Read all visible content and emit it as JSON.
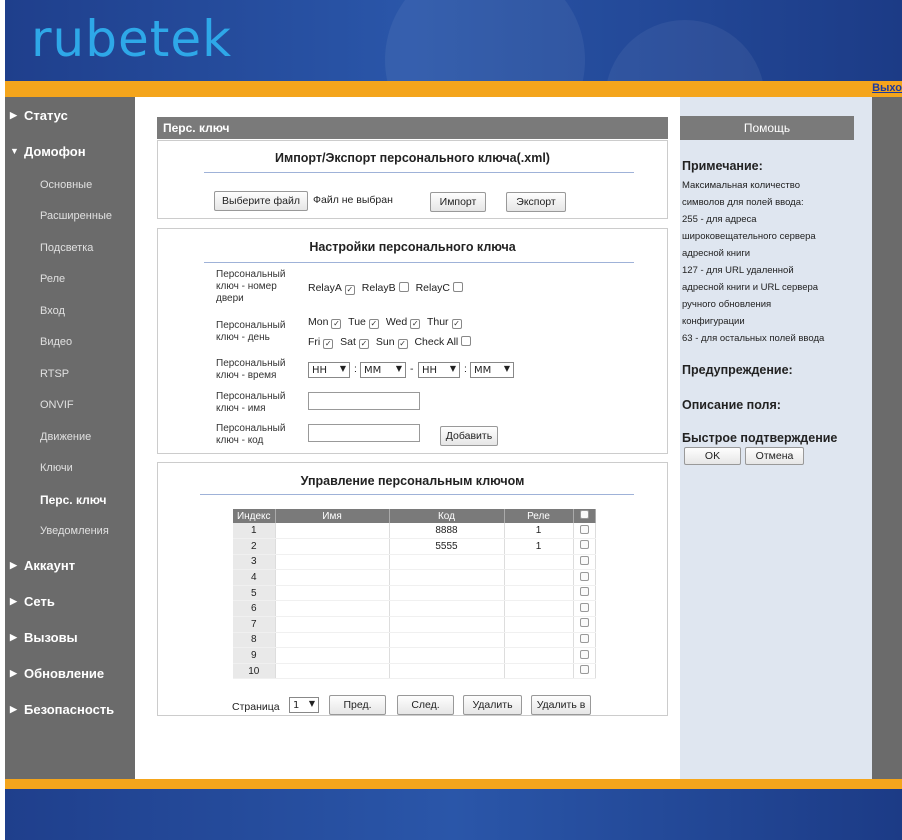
{
  "header": {
    "logo": "rubetek",
    "logout": "Выхо"
  },
  "sidebar": [
    {
      "label": "Статус",
      "type": "top",
      "expanded": false
    },
    {
      "label": "Домофон",
      "type": "top",
      "expanded": true
    },
    {
      "label": "Основные",
      "type": "sub"
    },
    {
      "label": "Расширенные",
      "type": "sub"
    },
    {
      "label": "Подсветка",
      "type": "sub"
    },
    {
      "label": "Реле",
      "type": "sub"
    },
    {
      "label": "Вход",
      "type": "sub"
    },
    {
      "label": "Видео",
      "type": "sub"
    },
    {
      "label": "RTSP",
      "type": "sub"
    },
    {
      "label": "ONVIF",
      "type": "sub"
    },
    {
      "label": "Движение",
      "type": "sub"
    },
    {
      "label": "Ключи",
      "type": "sub"
    },
    {
      "label": "Перс. ключ",
      "type": "sub",
      "active": true
    },
    {
      "label": "Уведомления",
      "type": "sub"
    },
    {
      "label": "Аккаунт",
      "type": "top",
      "expanded": false
    },
    {
      "label": "Сеть",
      "type": "top",
      "expanded": false
    },
    {
      "label": "Вызовы",
      "type": "top",
      "expanded": false
    },
    {
      "label": "Обновление",
      "type": "top",
      "expanded": false
    },
    {
      "label": "Безопасность",
      "type": "top",
      "expanded": false
    }
  ],
  "page_title": "Перс. ключ",
  "import_export": {
    "title": "Импорт/Экспорт персонального ключа(.xml)",
    "choose_file": "Выберите файл",
    "no_file": "Файл не выбран",
    "import": "Импорт",
    "export": "Экспорт"
  },
  "settings": {
    "title": "Настройки персонального ключа",
    "door_label": "Персональный ключ - номер двери",
    "relays": [
      {
        "label": "RelayA",
        "checked": true
      },
      {
        "label": "RelayB",
        "checked": false
      },
      {
        "label": "RelayC",
        "checked": false
      }
    ],
    "day_label": "Персональный ключ - день",
    "days_row1": [
      {
        "label": "Mon",
        "checked": true
      },
      {
        "label": "Tue",
        "checked": true
      },
      {
        "label": "Wed",
        "checked": true
      },
      {
        "label": "Thur",
        "checked": true
      }
    ],
    "days_row2": [
      {
        "label": "Fri",
        "checked": true
      },
      {
        "label": "Sat",
        "checked": true
      },
      {
        "label": "Sun",
        "checked": true
      },
      {
        "label": "Check All",
        "checked": false
      }
    ],
    "time_label": "Персональный ключ - время",
    "time_start_hh": "HH",
    "time_start_mm": "MM",
    "time_end_hh": "HH",
    "time_end_mm": "MM",
    "colon": ":",
    "dash": "-",
    "name_label": "Персональный ключ - имя",
    "code_label": "Персональный ключ - код",
    "add": "Добавить"
  },
  "management": {
    "title": "Управление персональным ключом",
    "columns": [
      "Индекс",
      "Имя",
      "Код",
      "Реле"
    ],
    "rows": [
      {
        "index": "1",
        "name": "",
        "code": "8888",
        "relay": "1"
      },
      {
        "index": "2",
        "name": "",
        "code": "5555",
        "relay": "1"
      },
      {
        "index": "3",
        "name": "",
        "code": "",
        "relay": ""
      },
      {
        "index": "4",
        "name": "",
        "code": "",
        "relay": ""
      },
      {
        "index": "5",
        "name": "",
        "code": "",
        "relay": ""
      },
      {
        "index": "6",
        "name": "",
        "code": "",
        "relay": ""
      },
      {
        "index": "7",
        "name": "",
        "code": "",
        "relay": ""
      },
      {
        "index": "8",
        "name": "",
        "code": "",
        "relay": ""
      },
      {
        "index": "9",
        "name": "",
        "code": "",
        "relay": ""
      },
      {
        "index": "10",
        "name": "",
        "code": "",
        "relay": ""
      }
    ],
    "page_label": "Страница",
    "page_value": "1",
    "prev": "Пред.",
    "next": "След.",
    "delete": "Удалить",
    "delete_all": "Удалить в"
  },
  "help": {
    "header": "Помощь",
    "note_title": "Примечание:",
    "note_lines": [
      "Максимальная количество",
      "символов для полей ввода:",
      "255 - для адреса",
      "широковещательного сервера",
      "адресной книги",
      "127 - для URL удаленной",
      "адресной книги и URL сервера",
      "ручного обновления",
      "конфигурации",
      "63 - для остальных полей ввода"
    ],
    "warning_title": "Предупреждение:",
    "field_desc_title": "Описание поля:",
    "quick_confirm_title": "Быстрое подтверждение",
    "ok": "OK",
    "cancel": "Отмена"
  },
  "colors": {
    "accent_orange": "#f4a51c",
    "header_blue": "#2a56a9",
    "logo_blue": "#2ea8e8",
    "sidebar_gray": "#6b6b6b"
  }
}
